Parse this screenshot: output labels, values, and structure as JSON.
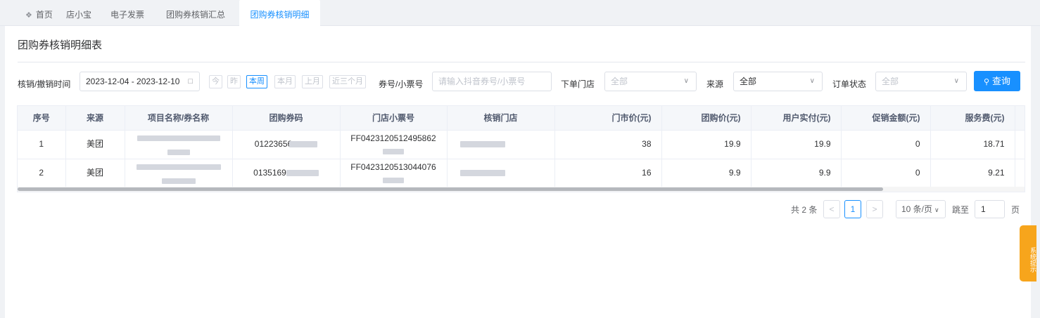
{
  "tabs": [
    {
      "label": "首页",
      "icon": "home-icon"
    },
    {
      "label": "店小宝"
    },
    {
      "label": "电子发票"
    },
    {
      "label": "团购券核销汇总"
    },
    {
      "label": "团购券核销明细",
      "active": true
    }
  ],
  "page": {
    "title": "团购券核销明细表"
  },
  "filters": {
    "time_label": "核销/撤销时间",
    "date_range": "2023-12-04 - 2023-12-10",
    "quick": [
      "今",
      "昨",
      "本周",
      "本月",
      "上月",
      "近三个月"
    ],
    "quick_active": "本周",
    "coupon_label": "券号/小票号",
    "coupon_placeholder": "请输入抖音券号/小票号",
    "store_label": "下单门店",
    "store_value": "全部",
    "source_label": "来源",
    "source_value": "全部",
    "status_label": "订单状态",
    "status_value": "全部",
    "search_button": "查询"
  },
  "table": {
    "columns": [
      "序号",
      "来源",
      "项目名称/券名称",
      "团购券码",
      "门店小票号",
      "核销门店",
      "门市价(元)",
      "团购价(元)",
      "用户实付(元)",
      "促销金额(元)",
      "服务费(元)"
    ],
    "rows": [
      {
        "no": "1",
        "source": "美团",
        "item": "",
        "code": "01223656",
        "ticket": "FF0423120512495862",
        "store": "",
        "market_price": "38",
        "group_price": "19.9",
        "paid": "19.9",
        "promo": "0",
        "fee": "18.71"
      },
      {
        "no": "2",
        "source": "美团",
        "item": "",
        "code": "0135169",
        "ticket": "FF0423120513044076",
        "store": "",
        "market_price": "16",
        "group_price": "9.9",
        "paid": "9.9",
        "promo": "0",
        "fee": "9.21"
      }
    ]
  },
  "pagination": {
    "total": "共 2 条",
    "prev": "<",
    "current": "1",
    "next": ">",
    "page_size": "10 条/页",
    "jump_label": "跳至",
    "jump_value": "1",
    "unit": "页"
  },
  "side_notice": "系统提示",
  "colors": {
    "accent": "#1890ff",
    "notice": "#f7a51c"
  }
}
